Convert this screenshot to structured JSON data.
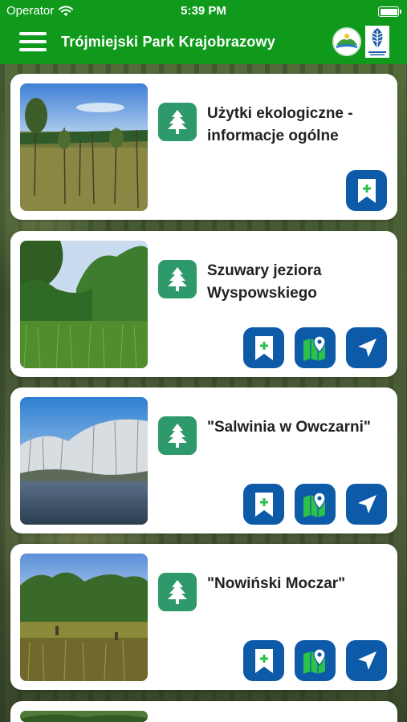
{
  "status_bar": {
    "carrier": "Operator",
    "time": "5:39 PM"
  },
  "header": {
    "title": "Trójmiejski Park Krajobrazowy"
  },
  "items": [
    {
      "title": "Użytki ekologiczne - informacje ogólne",
      "actions": [
        "bookmark-add"
      ]
    },
    {
      "title": "Szuwary jeziora Wyspowskiego",
      "actions": [
        "bookmark-add",
        "map",
        "navigate"
      ]
    },
    {
      "title": "\"Salwinia w Owczarni\"",
      "actions": [
        "bookmark-add",
        "map",
        "navigate"
      ]
    },
    {
      "title": "\"Nowiński Moczar\"",
      "actions": [
        "bookmark-add",
        "map",
        "navigate"
      ]
    }
  ],
  "colors": {
    "header": "#0f9a1c",
    "badge": "#2e9a6b",
    "action": "#0c5aa8"
  }
}
